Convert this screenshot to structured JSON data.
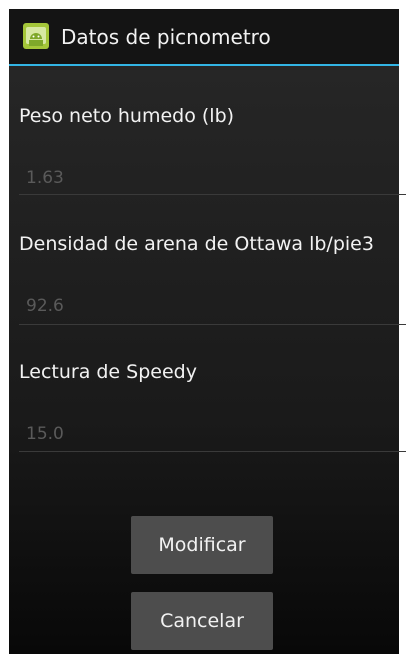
{
  "title_bar": {
    "title": "Datos de picnometro",
    "icon": "android-app-icon"
  },
  "fields": [
    {
      "label": "Peso neto humedo (lb)",
      "value": "1.63"
    },
    {
      "label": "Densidad de arena de Ottawa lb/pie3",
      "value": "92.6"
    },
    {
      "label": "Lectura de Speedy",
      "value": "15.0"
    }
  ],
  "buttons": {
    "modify": "Modificar",
    "cancel": "Cancelar"
  },
  "colors": {
    "accent": "#33b5e5",
    "button": "#4d4d4d"
  }
}
